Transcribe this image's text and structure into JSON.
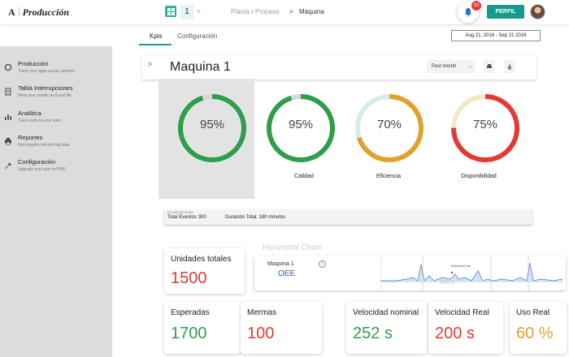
{
  "app": {
    "logo_letter": "A",
    "title": "Producción"
  },
  "topbar": {
    "page_number": "1",
    "breadcrumb": [
      "Planta",
      "Proceso",
      "Máquina"
    ],
    "notification_count": "10",
    "perfil_label": "PERFIL"
  },
  "tabs": [
    {
      "label": "Kpis",
      "active": true
    },
    {
      "label": "Configuración",
      "active": false
    }
  ],
  "date_range": "Aug 21, 2016 - Sep 21 2016",
  "sidebar": {
    "items": [
      {
        "icon": "circle-icon",
        "label": "Producción",
        "subtitle": "Track your apps across devices"
      },
      {
        "icon": "document-icon",
        "label": "Tabla Interrupciones",
        "subtitle": "View your results as Excel file"
      },
      {
        "icon": "bar-chart-icon",
        "label": "Analítica",
        "subtitle": "Track visits to your sites"
      },
      {
        "icon": "printer-icon",
        "label": "Reportes",
        "subtitle": "Get insights into the big data"
      },
      {
        "icon": "wrench-icon",
        "label": "Configuración",
        "subtitle": "Upgrade your plan to PRO"
      }
    ]
  },
  "machine": {
    "title": "Maquina 1",
    "period": "Past month"
  },
  "gauges": [
    {
      "value": 95,
      "label": "95%",
      "name": "",
      "color": "#2e9e48"
    },
    {
      "value": 95,
      "label": "95%",
      "name": "Calidad",
      "color": "#2e9e48"
    },
    {
      "value": 70,
      "label": "70%",
      "name": "Eficiencia",
      "color": "#e0a22a"
    },
    {
      "value": 75,
      "label": "75%",
      "name": "Disponibilidad",
      "color": "#e53935"
    }
  ],
  "stats": {
    "header": "ESTADISTICAS",
    "total_events": "Total Eventos 300",
    "total_duration": "Duración Total: 180 minutos"
  },
  "horizontal_chart": {
    "title": "Horizontal Chart",
    "machine": "Maquina 1",
    "metric": "OEE",
    "overlay_label": "Bars",
    "annotation": "Enhoured del"
  },
  "kpis": [
    {
      "label": "Unidades totales",
      "value": "1500",
      "color": "#e53935"
    },
    {
      "label": "Esperadas",
      "value": "1700",
      "color": "#2e9e48"
    },
    {
      "label": "Mermas",
      "value": "100",
      "color": "#e53935"
    },
    {
      "label": "Velocidad nominal",
      "value": "252 s",
      "color": "#2e9e48"
    },
    {
      "label": "Velocidad Real",
      "value": "200 s",
      "color": "#e53935"
    },
    {
      "label": "Uso Real",
      "value": "60 %",
      "color": "#e0a22a"
    }
  ]
}
